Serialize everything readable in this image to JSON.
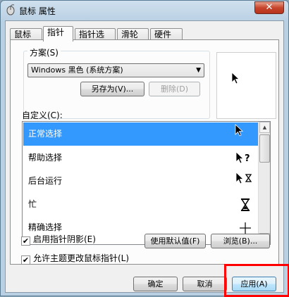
{
  "window": {
    "title": "鼠标 属性",
    "close_glyph": "✕"
  },
  "tabs": [
    {
      "label": "鼠标键",
      "active": false
    },
    {
      "label": "指针",
      "active": true
    },
    {
      "label": "指针选项",
      "active": false
    },
    {
      "label": "滑轮",
      "active": false
    },
    {
      "label": "硬件",
      "active": false
    }
  ],
  "scheme": {
    "label": "方案(S)",
    "selected": "Windows 黑色 (系统方案)",
    "save_as": "另存为(V)...",
    "delete": "删除(D)"
  },
  "customize": {
    "label": "自定义(C):",
    "items": [
      {
        "label": "正常选择",
        "icon": "arrow-cursor-icon",
        "selected": true
      },
      {
        "label": "帮助选择",
        "icon": "help-cursor-icon",
        "selected": false
      },
      {
        "label": "后台运行",
        "icon": "working-cursor-icon",
        "selected": false
      },
      {
        "label": "忙",
        "icon": "busy-hourglass-icon",
        "selected": false
      },
      {
        "label": "精确选择",
        "icon": "precision-cursor-icon",
        "selected": false
      }
    ]
  },
  "options": {
    "shadow": {
      "label": "启用指针阴影(E)",
      "checked": true
    },
    "theme": {
      "label": "允许主题更改鼠标指针(L)",
      "checked": true
    },
    "use_default": "使用默认值(F)",
    "browse": "浏览(B)..."
  },
  "footer": {
    "ok": "确定",
    "cancel": "取消",
    "apply": "应用(A)"
  },
  "colors": {
    "selection": "#3399ff",
    "highlight": "#ff0000"
  }
}
